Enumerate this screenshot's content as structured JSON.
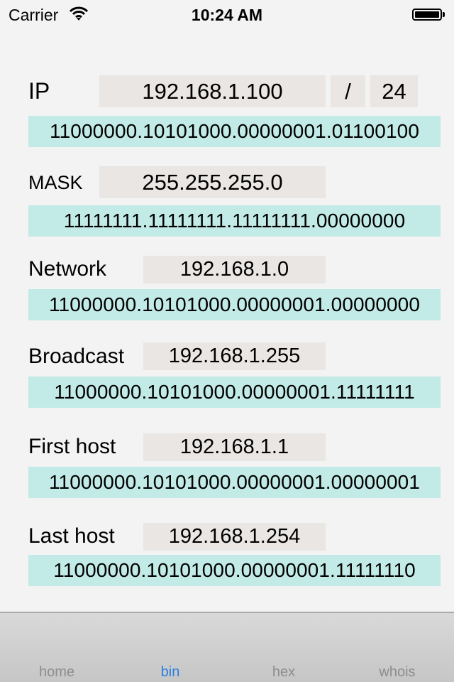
{
  "status_bar": {
    "carrier": "Carrier",
    "wifi_icon": "wifi-icon",
    "time": "10:24 AM",
    "battery_icon": "battery-full-icon"
  },
  "ip": {
    "label": "IP",
    "value": "192.168.1.100",
    "separator": "/",
    "prefix": "24",
    "binary": "11000000.10101000.00000001.01100100"
  },
  "mask": {
    "label": "MASK",
    "value": "255.255.255.0",
    "binary": "11111111.11111111.11111111.00000000"
  },
  "network": {
    "label": "Network",
    "value": "192.168.1.0",
    "binary": "11000000.10101000.00000001.00000000"
  },
  "broadcast": {
    "label": "Broadcast",
    "value": "192.168.1.255",
    "binary": "11000000.10101000.00000001.11111111"
  },
  "first_host": {
    "label": "First host",
    "value": "192.168.1.1",
    "binary": "11000000.10101000.00000001.00000001"
  },
  "last_host": {
    "label": "Last host",
    "value": "192.168.1.254",
    "binary": "11000000.10101000.00000001.11111110"
  },
  "tabs": [
    {
      "label": "home",
      "active": false
    },
    {
      "label": "bin",
      "active": true
    },
    {
      "label": "hex",
      "active": false
    },
    {
      "label": "whois",
      "active": false
    }
  ],
  "colors": {
    "background": "#f3f3f3",
    "value_box": "#e9e6e4",
    "binary_strip": "#c2eae6",
    "tab_active": "#2a7ee0",
    "tab_inactive": "#8d8d8d"
  }
}
